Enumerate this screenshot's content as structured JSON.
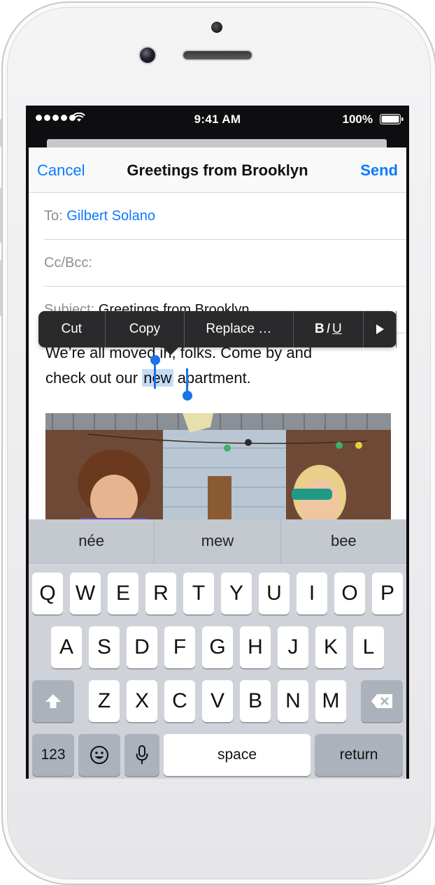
{
  "status_bar": {
    "time": "9:41 AM",
    "battery": "100%"
  },
  "compose": {
    "cancel": "Cancel",
    "title": "Greetings from Brooklyn",
    "send": "Send",
    "to_label": "To:",
    "to_value": "Gilbert Solano",
    "cc_label": "Cc/Bcc:",
    "subject_label": "Subject:",
    "subject_value": "Greetings from Brooklyn",
    "body_line1": "We’re all moved in, folks. Come by and",
    "body_line2_pre": "check out our",
    "body_selected": "new",
    "body_line2_post": "apartment."
  },
  "edit_menu": {
    "cut": "Cut",
    "copy": "Copy",
    "replace": "Replace …",
    "b": "B",
    "i": "I",
    "u": "U"
  },
  "keyboard": {
    "suggestions": [
      "née",
      "mew",
      "bee"
    ],
    "row1": [
      "Q",
      "W",
      "E",
      "R",
      "T",
      "Y",
      "U",
      "I",
      "O",
      "P"
    ],
    "row2": [
      "A",
      "S",
      "D",
      "F",
      "G",
      "H",
      "J",
      "K",
      "L"
    ],
    "row3": [
      "Z",
      "X",
      "C",
      "V",
      "B",
      "N",
      "M"
    ],
    "numbers": "123",
    "space": "space",
    "return": "return"
  },
  "colors": {
    "accent": "#0a7aff",
    "selection": "#c5dcf6",
    "menu_bg": "#2a2a2c",
    "keyboard_bg": "#cfd3d9"
  }
}
